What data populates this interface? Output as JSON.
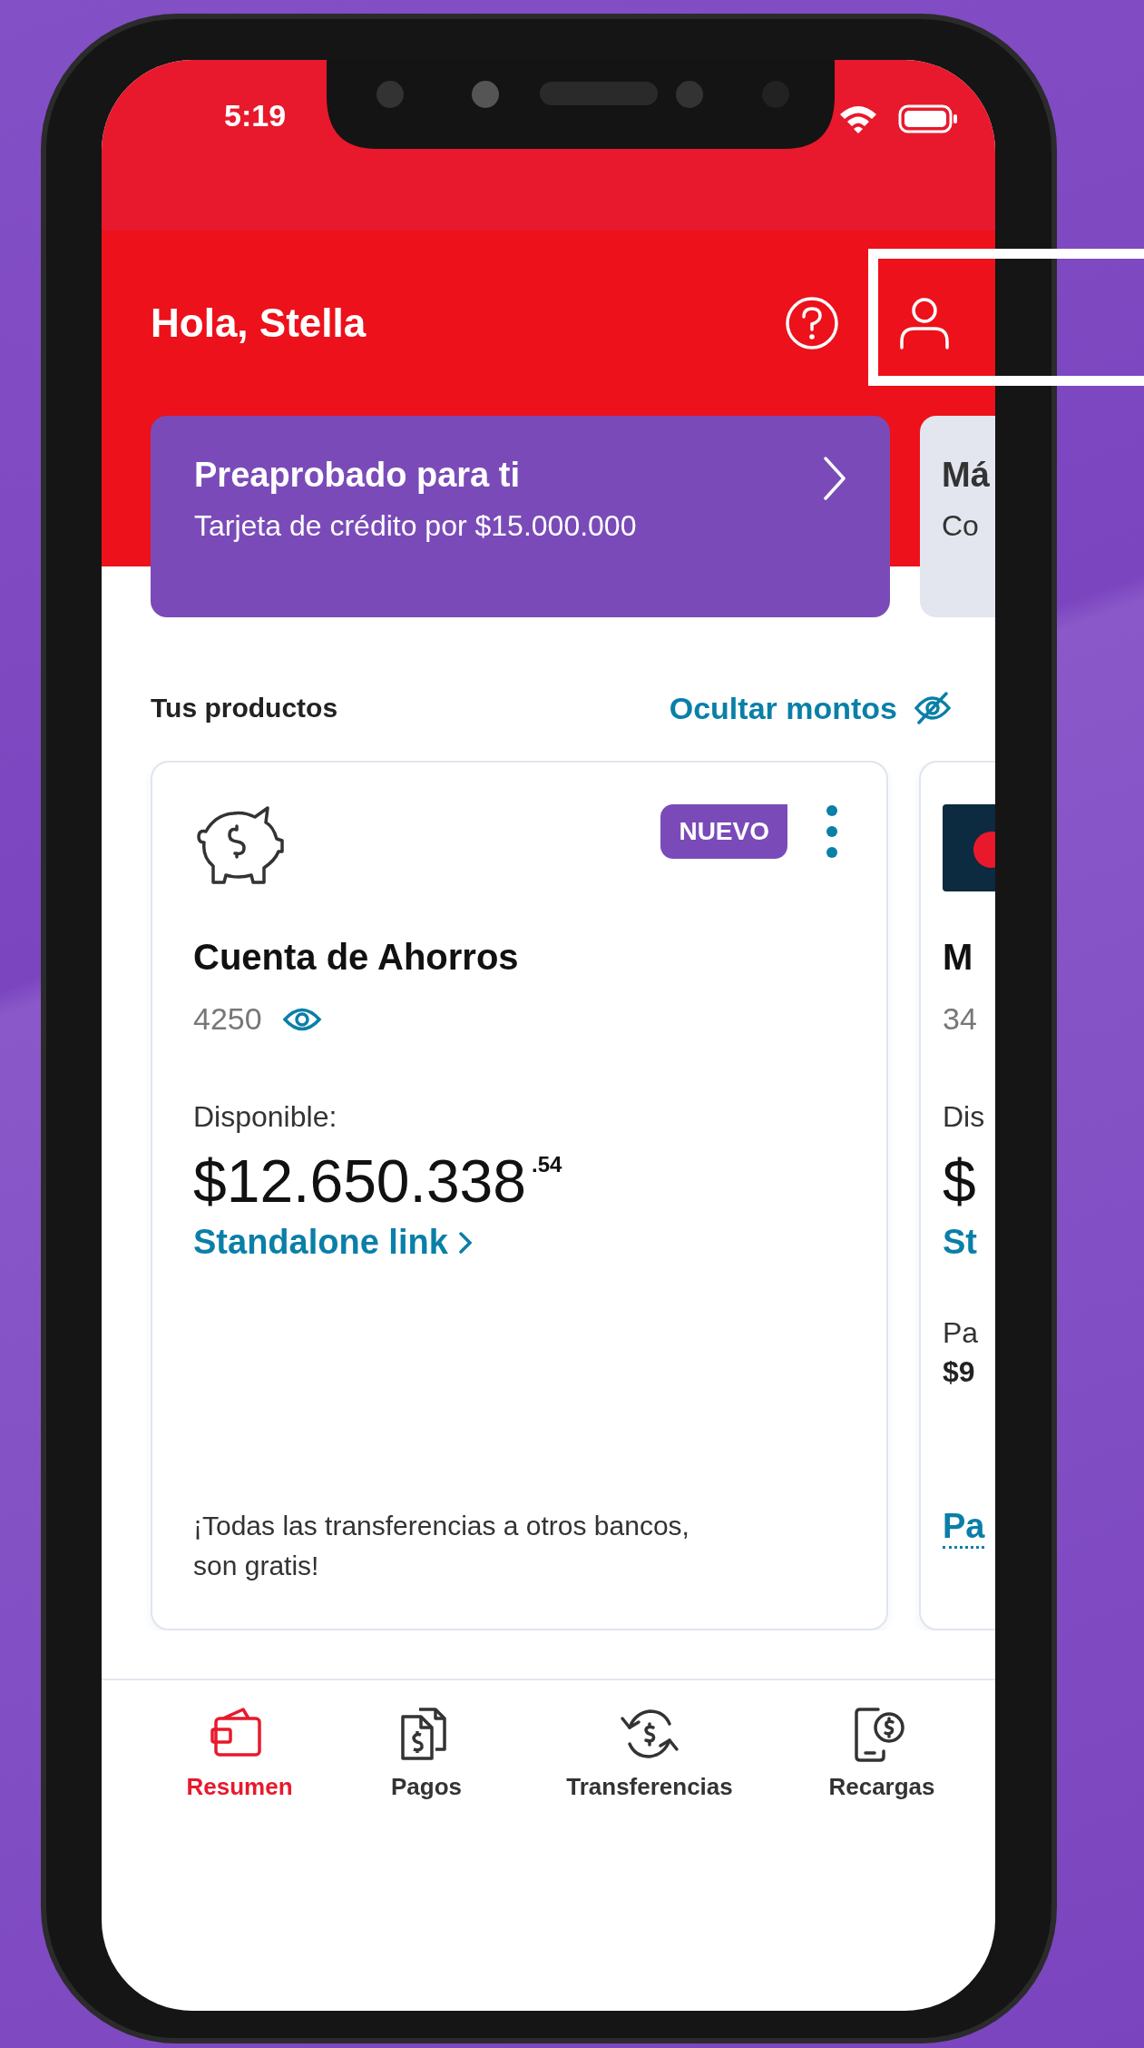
{
  "status_bar": {
    "time": "5:19"
  },
  "header": {
    "greeting": "Hola, Stella"
  },
  "promos": [
    {
      "kind": "featured",
      "title": "Preaprobado para ti",
      "subtitle": "Tarjeta de crédito por $15.000.000"
    },
    {
      "kind": "plain",
      "title": "Má",
      "subtitle": "Co"
    }
  ],
  "products_section": {
    "title": "Tus productos",
    "toggle": "Ocultar montos"
  },
  "products": [
    {
      "kind": "savings",
      "badge": "NUEVO",
      "title": "Cuenta de Ahorros",
      "number": "4250",
      "balance_label": "Disponible:",
      "balance": "$12.650.338",
      "cents": ".54",
      "link": "Standalone link",
      "footer": "¡Todas las transferencias a otros bancos, son gratis!"
    },
    {
      "kind": "card",
      "title": "M",
      "number": "34",
      "balance_label": "Dis",
      "balance": "$",
      "link": "St",
      "payment_label": "Pa",
      "payment_amount": "$9",
      "payment_link": "Pa"
    }
  ],
  "nav": [
    {
      "kind": "wallet",
      "label": "Resumen",
      "selected": true
    },
    {
      "kind": "bills",
      "label": "Pagos",
      "selected": false
    },
    {
      "kind": "transfer",
      "label": "Transferencias",
      "selected": false
    },
    {
      "kind": "topup",
      "label": "Recargas",
      "selected": false
    }
  ]
}
